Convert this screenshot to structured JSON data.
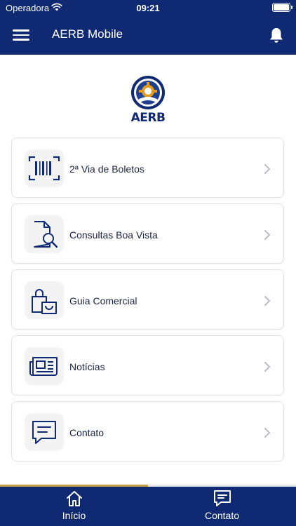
{
  "status_bar": {
    "carrier": "Operadora",
    "time": "09:21"
  },
  "header": {
    "title": "AERB Mobile",
    "menu_icon": "hamburger-menu-icon",
    "bell_icon": "bell-icon"
  },
  "logo": {
    "text": "AERB"
  },
  "menu": {
    "items": [
      {
        "label": "2ª Via de Boletos",
        "icon": "barcode-icon"
      },
      {
        "label": "Consultas Boa Vista",
        "icon": "document-search-icon"
      },
      {
        "label": "Guia Comercial",
        "icon": "shopping-bags-icon"
      },
      {
        "label": "Notícias",
        "icon": "newspaper-icon"
      },
      {
        "label": "Contato",
        "icon": "chat-message-icon"
      }
    ]
  },
  "tabbar": {
    "home_label": "Início",
    "contact_label": "Contato"
  },
  "colors": {
    "primary": "#0f2a73",
    "accent": "#c9a04a",
    "card_border": "#e3e3e6",
    "icon_box": "#f3f3f4"
  }
}
